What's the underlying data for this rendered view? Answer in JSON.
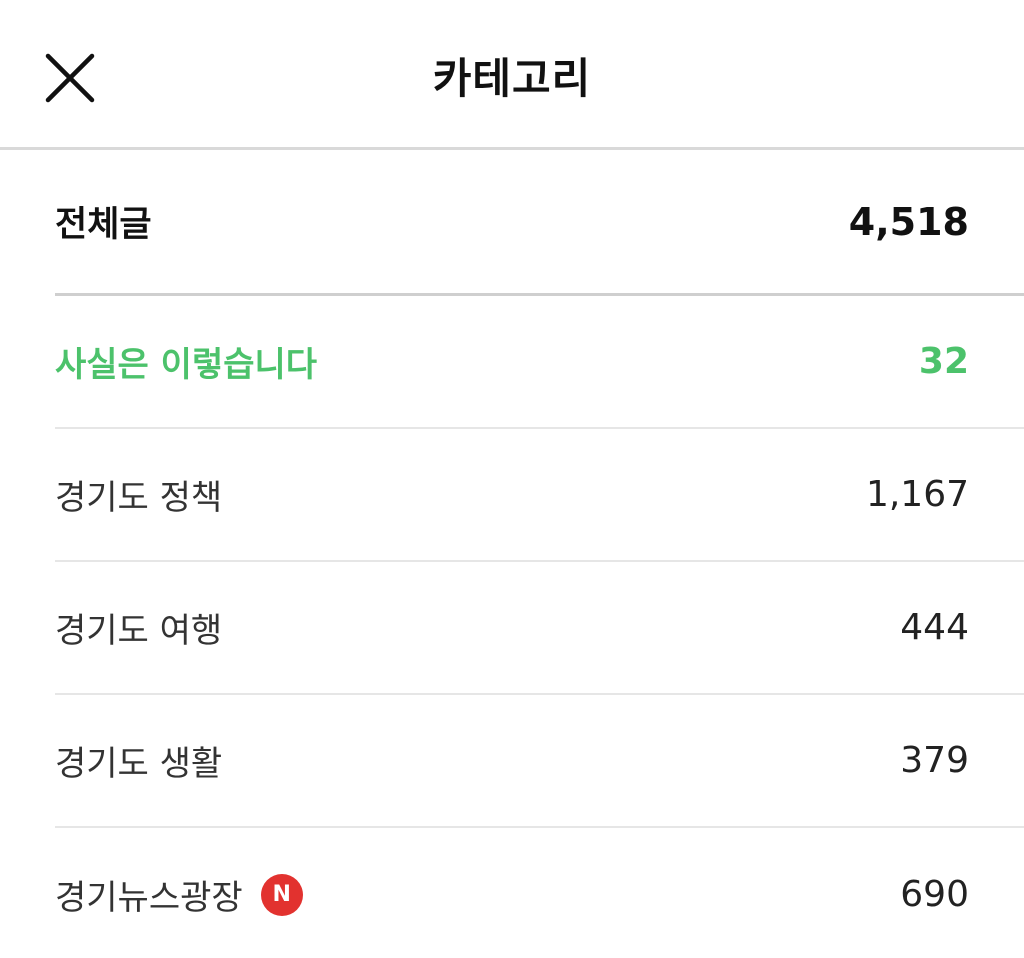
{
  "header": {
    "title": "카테고리",
    "close_icon": "close-icon"
  },
  "categories": [
    {
      "label": "전체글",
      "count": "4,518",
      "style": "all"
    },
    {
      "label": "사실은 이렇습니다",
      "count": "32",
      "style": "highlight",
      "color": "#4cc26b"
    },
    {
      "label": "경기도 정책",
      "count": "1,167"
    },
    {
      "label": "경기도 여행",
      "count": "444"
    },
    {
      "label": "경기도 생활",
      "count": "379"
    },
    {
      "label": "경기뉴스광장",
      "count": "690",
      "badge": "N",
      "badge_color": "#e2322f"
    }
  ]
}
